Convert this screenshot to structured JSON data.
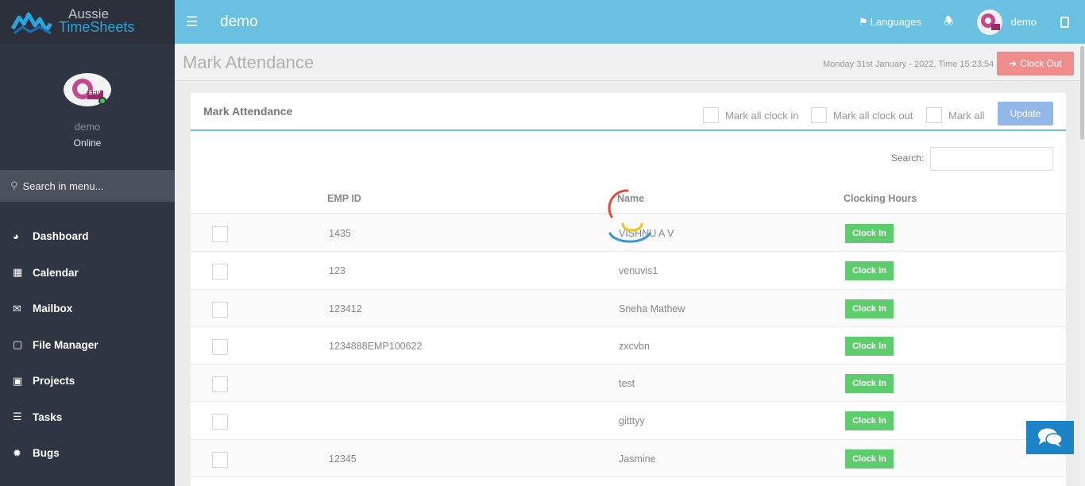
{
  "sidebar": {
    "logo_line1": "Aussie",
    "logo_line2": "TimeSheets",
    "user_name": "demo",
    "user_status": "Online",
    "avatar_label": "ERP",
    "search_placeholder": "Search in menu...",
    "menu": [
      {
        "label": "Dashboard",
        "icon": "dashboard-icon"
      },
      {
        "label": "Calendar",
        "icon": "calendar-icon"
      },
      {
        "label": "Mailbox",
        "icon": "envelope-icon"
      },
      {
        "label": "File Manager",
        "icon": "file-icon"
      },
      {
        "label": "Projects",
        "icon": "folder-open-icon"
      },
      {
        "label": "Tasks",
        "icon": "tasks-icon"
      },
      {
        "label": "Bugs",
        "icon": "bug-icon"
      }
    ]
  },
  "topbar": {
    "title": "demo",
    "languages_label": "Languages",
    "user_name": "demo"
  },
  "header": {
    "page_title": "Mark Attendance",
    "datetime": "Monday 31st January - 2022,  Time  15:23:54",
    "clock_out_label": "Clock Out"
  },
  "box": {
    "title": "Mark Attendance",
    "mark_all_clock_in": "Mark all clock in",
    "mark_all_clock_out": "Mark all clock out",
    "mark_all": "Mark all",
    "update_label": "Update",
    "search_label": "Search:"
  },
  "table": {
    "columns": [
      "EMP ID",
      "Name",
      "Clocking Hours"
    ],
    "rows": [
      {
        "emp_id": "1435",
        "name": "VISHNU A V",
        "action": "Clock In"
      },
      {
        "emp_id": "123",
        "name": "venuvis1",
        "action": "Clock In"
      },
      {
        "emp_id": "123412",
        "name": "Sneha Mathew",
        "action": "Clock In"
      },
      {
        "emp_id": "1234888EMP100622",
        "name": "zxcvbn",
        "action": "Clock In"
      },
      {
        "emp_id": "",
        "name": "test",
        "action": "Clock In"
      },
      {
        "emp_id": "",
        "name": "gitttyy",
        "action": "Clock In"
      },
      {
        "emp_id": "12345",
        "name": "Jasmine",
        "action": "Clock In"
      }
    ]
  },
  "colors": {
    "topbar": "#6ac0e0",
    "sidebar": "#2f3542",
    "clock_out": "#ee8d8b",
    "update": "#92b7e8",
    "clock_in": "#5dcc6c",
    "chat": "#1c84c6"
  }
}
